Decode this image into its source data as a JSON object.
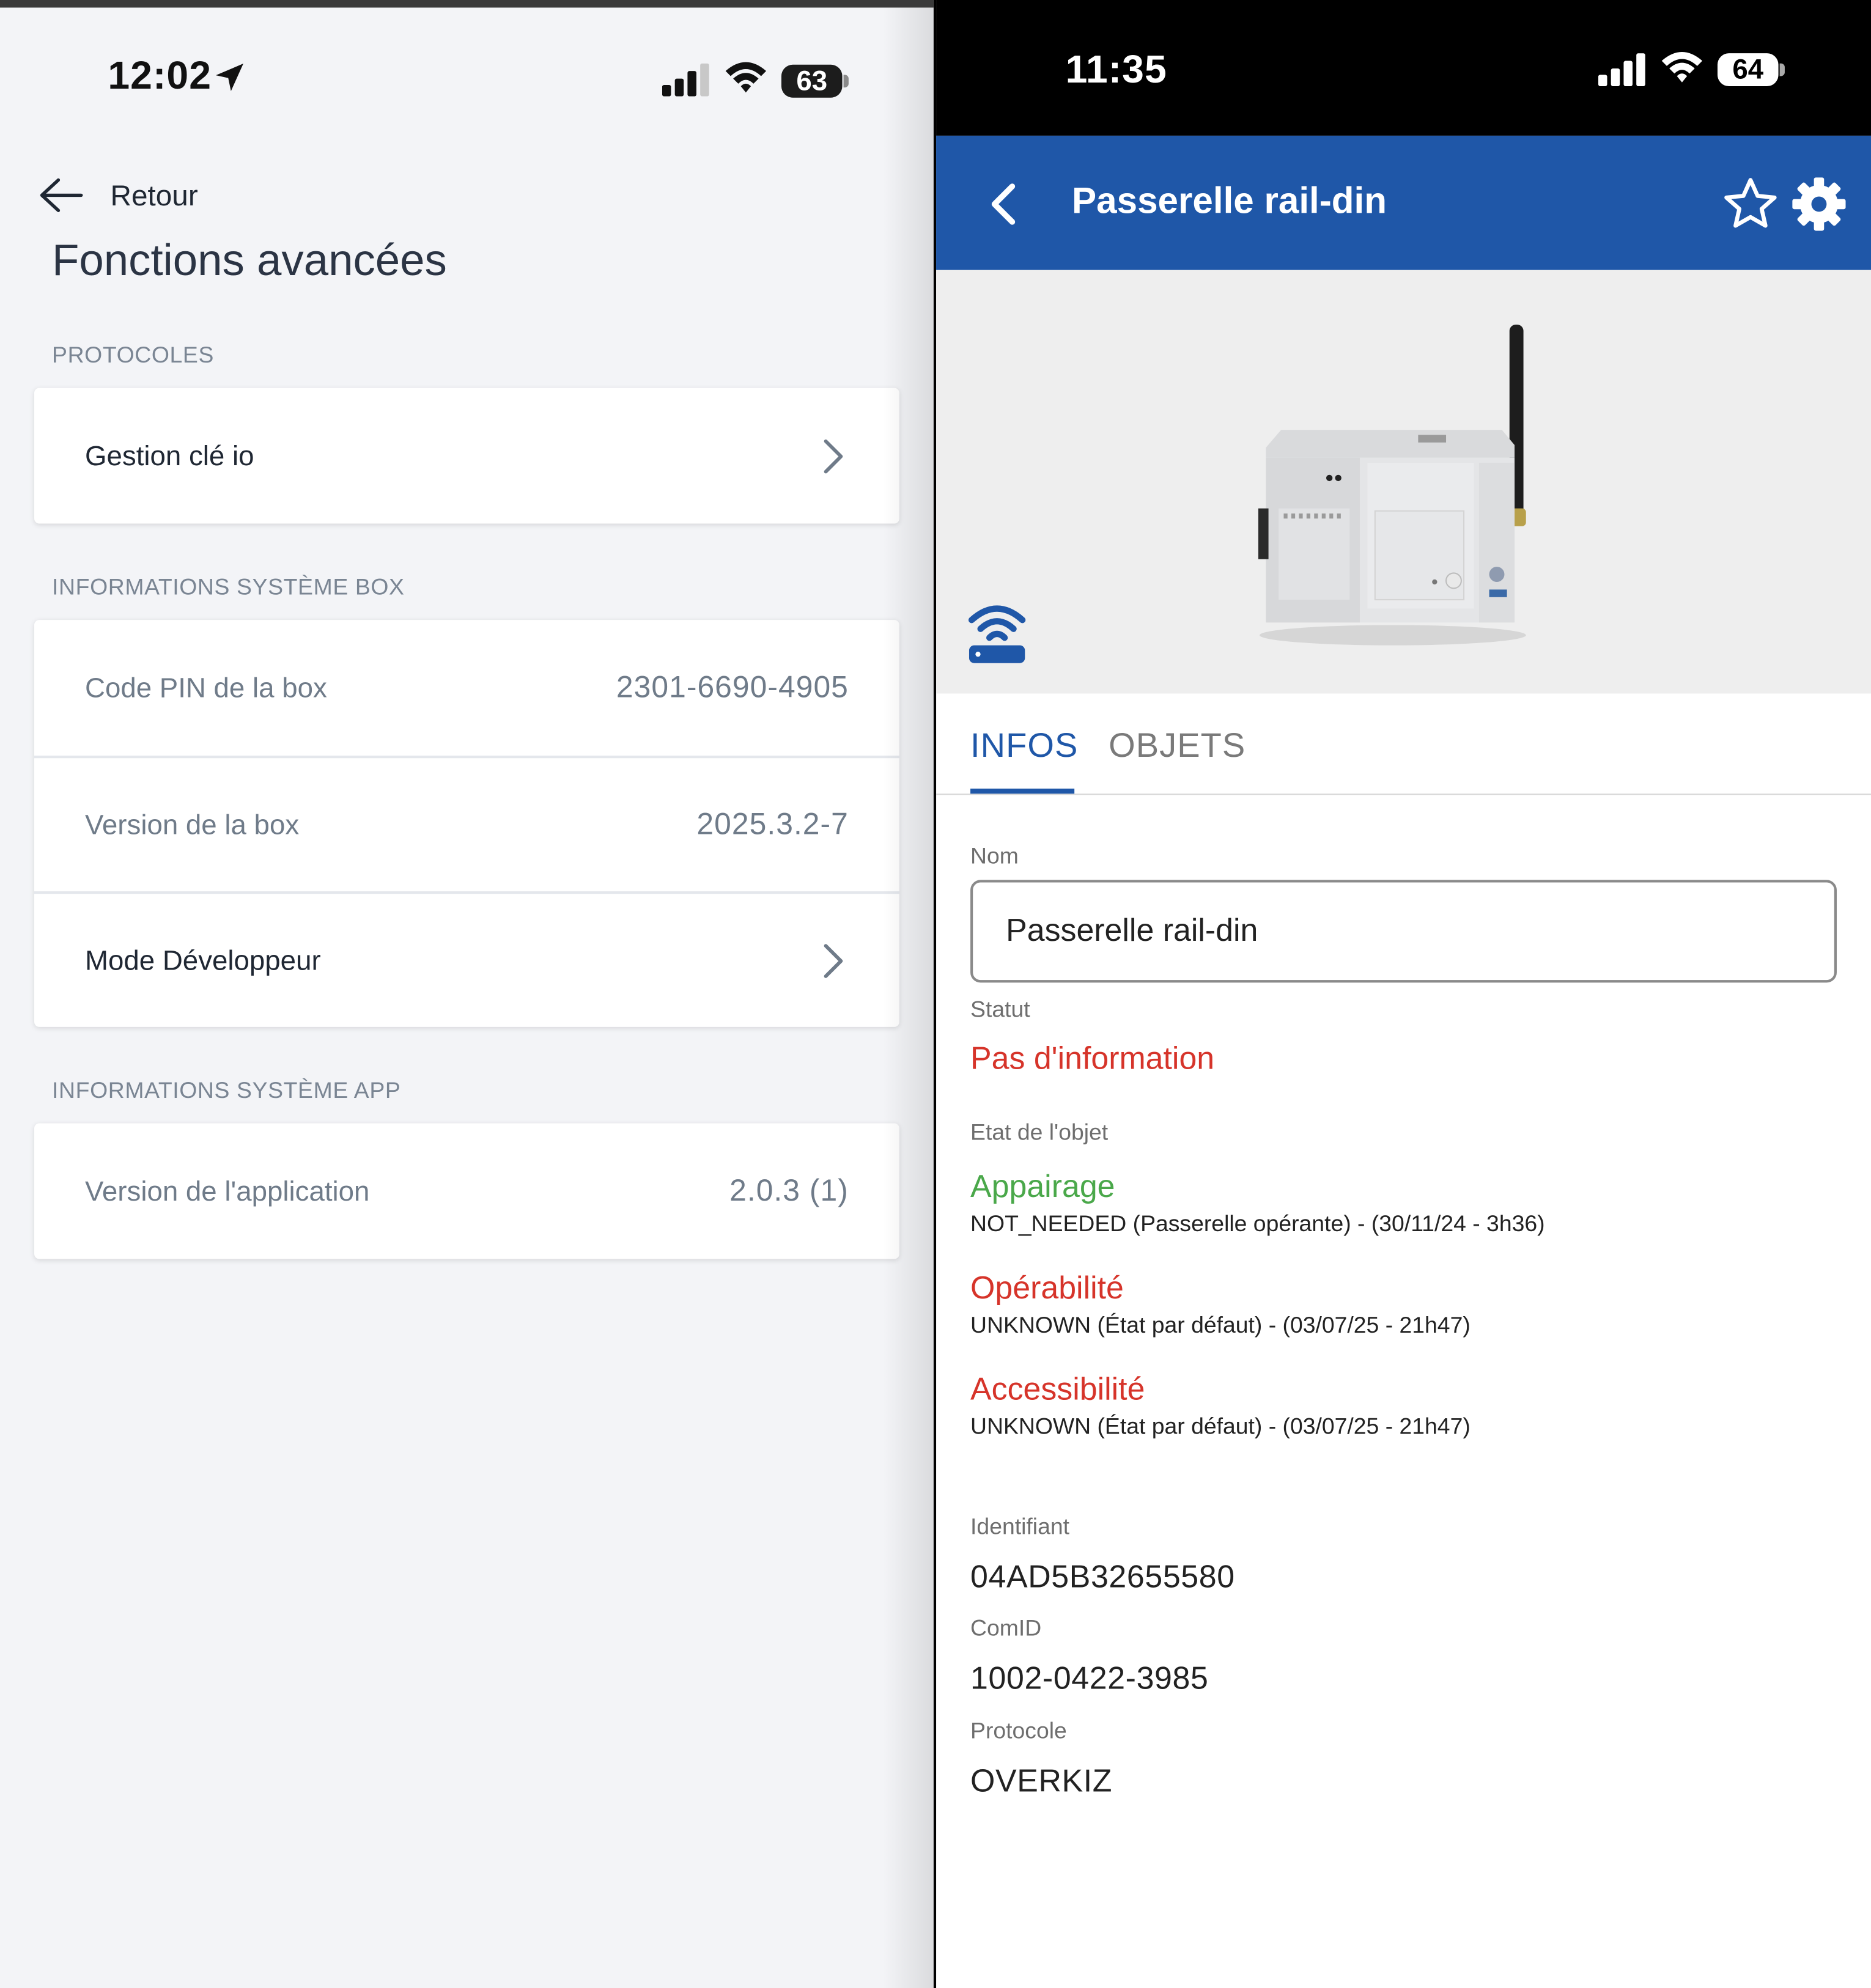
{
  "left": {
    "status_bar": {
      "time": "12:02",
      "battery": "63"
    },
    "back_label": "Retour",
    "title": "Fonctions avancées",
    "sections": {
      "protocols": {
        "label": "PROTOCOLES",
        "items": [
          {
            "label": "Gestion clé io"
          }
        ]
      },
      "box_info": {
        "label": "INFORMATIONS SYSTÈME BOX",
        "items": [
          {
            "label": "Code PIN de la box",
            "value": "2301-6690-4905"
          },
          {
            "label": "Version de la box",
            "value": "2025.3.2-7"
          },
          {
            "label": "Mode Développeur"
          }
        ]
      },
      "app_info": {
        "label": "INFORMATIONS SYSTÈME APP",
        "items": [
          {
            "label": "Version de l'application",
            "value": "2.0.3 (1)"
          }
        ]
      }
    }
  },
  "right": {
    "status_bar": {
      "time": "11:35",
      "battery": "64"
    },
    "app_bar": {
      "title": "Passerelle rail-din"
    },
    "tabs": [
      {
        "label": "INFOS"
      },
      {
        "label": "OBJETS"
      }
    ],
    "fields": {
      "name_label": "Nom",
      "name_value": "Passerelle rail-din",
      "status_label": "Statut",
      "status_value": "Pas d'information",
      "object_state_label": "Etat de l'objet",
      "states": [
        {
          "title": "Appairage",
          "detail": "NOT_NEEDED (Passerelle opérante) - (30/11/24 - 3h36)"
        },
        {
          "title": "Opérabilité",
          "detail": "UNKNOWN (État par défaut) - (03/07/25 - 21h47)"
        },
        {
          "title": "Accessibilité",
          "detail": "UNKNOWN (État par défaut) - (03/07/25 - 21h47)"
        }
      ],
      "identifier_label": "Identifiant",
      "identifier_value": "04AD5B32655580",
      "comid_label": "ComID",
      "comid_value": "1002-0422-3985",
      "protocol_label": "Protocole",
      "protocol_value": "OVERKIZ"
    },
    "colors": {
      "app_bar": "#1f57a8",
      "state_ok": "#4aa84a",
      "state_error": "#d6342a"
    }
  }
}
